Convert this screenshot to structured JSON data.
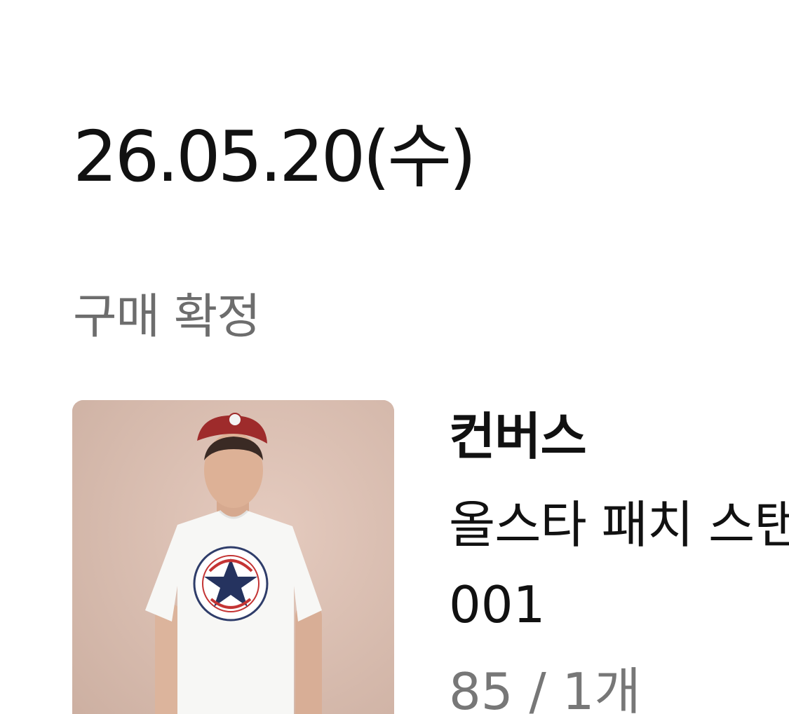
{
  "order": {
    "date": "26.05.20(수)",
    "status": "구매 확정"
  },
  "product": {
    "image_icon": "product-photo",
    "brand": "컨버스",
    "name": "올스타 패치 스탠다드 핏 반팔 티셔츠",
    "code": "001",
    "option": "85 / 1개"
  },
  "colors": {
    "text_primary": "#111111",
    "text_secondary": "#6d6d6d",
    "card_bg": "#d9bdaf"
  }
}
